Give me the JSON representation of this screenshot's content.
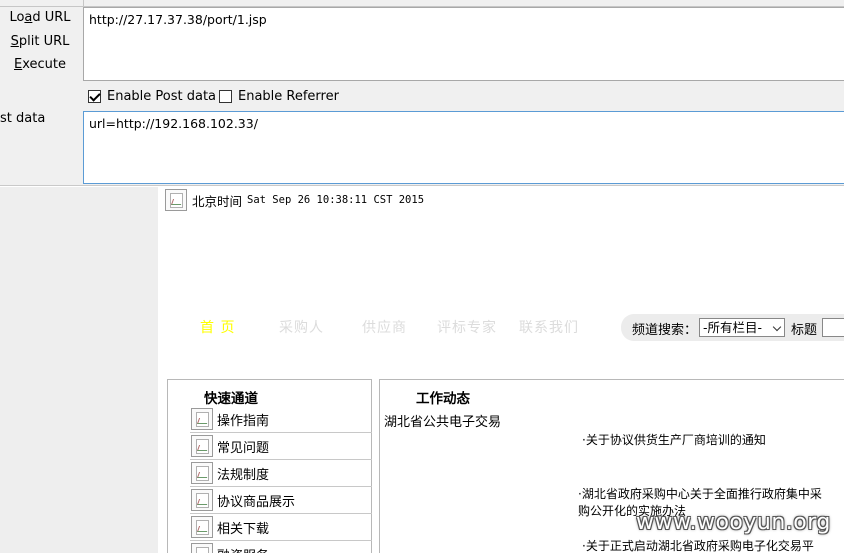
{
  "actions": {
    "load_url": "Load URL",
    "load_url_u": "a",
    "split_url": "Split URL",
    "execute": "Execute"
  },
  "url_field": {
    "value": "http://27.17.37.38/port/1.jsp"
  },
  "options": {
    "enable_post": "Enable Post data",
    "enable_post_checked": true,
    "enable_referrer": "Enable Referrer",
    "enable_referrer_checked": false
  },
  "post": {
    "label": "st data",
    "value": "url=http://192.168.102.33/"
  },
  "page": {
    "time_label": "北京时间",
    "time_value": "Sat Sep 26 10:38:11 CST 2015",
    "nav": [
      "首 页",
      "采购人",
      "供应商",
      "评标专家",
      "联系我们"
    ],
    "search": {
      "label": "频道搜索：",
      "select_value": "-所有栏目-",
      "title_label": "标题"
    },
    "quick": {
      "title": "快速通道",
      "items": [
        "操作指南",
        "常见问题",
        "法规制度",
        "协议商品展示",
        "相关下载",
        "融资服务"
      ]
    },
    "work": {
      "title": "工作动态",
      "subtitle": "湖北省公共电子交易",
      "news": [
        "·关于协议供货生产厂商培训的通知",
        "·湖北省政府采购中心关于全面推行政府集中采购公开化的实施办法",
        "·关于正式启动湖北省政府采购电子化交易平"
      ]
    }
  },
  "watermark": "www.wooyun.org",
  "colors": {
    "nav_active": "#ffff00",
    "nav_dim": "#dcdcdc",
    "post_border": "#5b9bd5"
  }
}
